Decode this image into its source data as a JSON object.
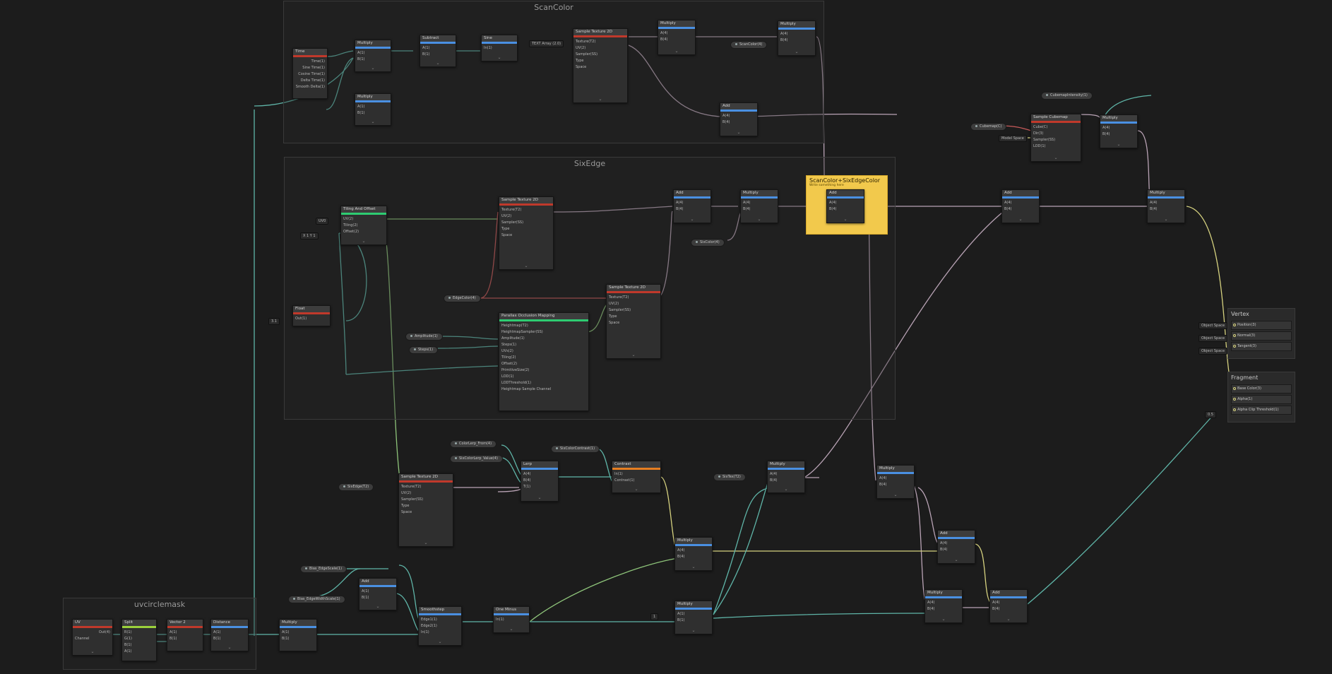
{
  "groups": {
    "scan_color": "ScanColor",
    "six_edge": "SixEdge",
    "uvcircle": "uvcirclemask"
  },
  "sticky": {
    "title": "ScanColor+SixEdgeColor",
    "subtitle": "Write something here"
  },
  "master": {
    "vertex_title": "Vertex",
    "vertex_ports": [
      "Position(3)",
      "Normal(3)",
      "Tangent(3)"
    ],
    "vertex_space": "Object Space",
    "fragment_title": "Fragment",
    "fragment_ports": [
      "Base Color(3)",
      "Alpha(1)",
      "Alpha Clip Threshold(1)"
    ],
    "alpha_clip_value": "0.5"
  },
  "nodes": {
    "time": {
      "title": "Time",
      "ports": [
        "Time(1)",
        "Sine Time(1)",
        "Cosine Time(1)",
        "Delta Time(1)",
        "Smooth Delta(1)"
      ]
    },
    "multiply": "Multiply",
    "add": "Add",
    "subtract": "Subtract",
    "sine": "Sine",
    "sample_texture": "Sample Texture 2D",
    "sample_cubemap": "Sample Cubemap",
    "tiling_offset": "Tiling And Offset",
    "float": "Float",
    "pom": "Parallax Occlusion Mapping",
    "lerp": "Lerp",
    "contrast": "Contrast",
    "smoothstep": "Smoothstep",
    "one_minus": "One Minus",
    "uv": "UV",
    "split": "Split",
    "vector2": "Vector 2",
    "distance": "Distance",
    "ports": {
      "a": "A(1)",
      "b": "B(1)",
      "out": "Out(1)",
      "a4": "A(4)",
      "b4": "B(4)",
      "out4": "Out(4)",
      "in": "In(1)",
      "t": "T(1)",
      "edge1": "Edge1(1)",
      "edge2": "Edge2(1)",
      "texture": "Texture(T2)",
      "uv2": "UV(2)",
      "sampler": "Sampler(SS)",
      "rgba": "RGBA(4)",
      "r": "R(1)",
      "g": "G(1)",
      "b1": "B(1)",
      "a1": "A(1)",
      "type": "Type",
      "space": "Space",
      "type_val": "Default",
      "space_val": "Tangent",
      "tiling": "Tiling(2)",
      "offset": "Offset(2)",
      "contrast_in": "Contrast(1)",
      "cube": "Cube(C)",
      "dir": "Dir(3)",
      "lod": "LOD(1)",
      "channel": "Channel",
      "channel_val": "UV0",
      "pom_in": [
        "Heightmap(T2)",
        "HeightmapSampler(SS)",
        "Amplitude(1)",
        "Steps(1)",
        "UVs(2)",
        "Tiling(2)",
        "Offset(2)",
        "PrimitiveSize(2)",
        "LOD(1)",
        "LODThreshold(1)"
      ],
      "pom_out": [
        "PixelDepthOffset(1)",
        "ParallaxUVs(2)"
      ],
      "pom_mode": "Heightmap Sample Channel",
      "pom_mode_val": "Red"
    }
  },
  "properties": {
    "scan_color": "ScanColor(4)",
    "cubemap": "CubemapIntensity(1)",
    "cube": "Cubemap(C)",
    "model_space": "Model Space",
    "edge_color": "EdgeColor(4)",
    "six_edge": "SixEdge(T2)",
    "amplitude": "Amplitude(1)",
    "steps": "Steps(1)",
    "uv0": "UV0",
    "color_lerp_from": "ColorLerp_From(4)",
    "color_lerp_to": "SixColorLerp_Value(4)",
    "contrast_val": "SixColorContrast(1)",
    "six_tex": "SixTex(T2)",
    "glow_color": "SixColor(4)",
    "bias_edge": "Bias_EdgeScale(1)",
    "bias_width": "Bias_EdgeWidthScale(1)",
    "scan_tex": "TEXT Array (2.0)"
  },
  "values": {
    "v05": "0.5",
    "v1": "1",
    "v0": "0",
    "v3": "3.1",
    "xy": "X 1  Y 1",
    "x0": "X 0  Y 0"
  },
  "colors": {
    "blue": "#4a90e2",
    "red": "#c0392b",
    "green": "#2ecc71",
    "lime": "#9bd13b",
    "orange": "#e67e22",
    "yellow": "#f2c94c"
  }
}
